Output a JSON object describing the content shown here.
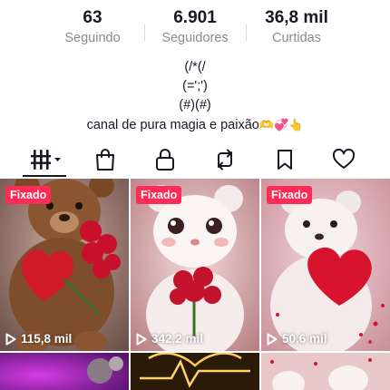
{
  "stats": {
    "following": {
      "value": "63",
      "label": "Seguindo"
    },
    "followers": {
      "value": "6.901",
      "label": "Seguidores"
    },
    "likes": {
      "value": "36,8 mil",
      "label": "Curtidas"
    }
  },
  "bio": {
    "lines": [
      "(/*(/",
      "(=';')",
      "(#)(#)"
    ],
    "text": "canal de pura magia e paixão",
    "emojis": "🫶💞👆"
  },
  "tabs": [
    {
      "name": "videos",
      "icon": "grid-bars-icon",
      "selected": true
    },
    {
      "name": "shop",
      "icon": "shopping-bag-icon"
    },
    {
      "name": "private",
      "icon": "lock-icon"
    },
    {
      "name": "reposts",
      "icon": "repost-icon"
    },
    {
      "name": "favorites",
      "icon": "bookmark-icon"
    },
    {
      "name": "liked",
      "icon": "heart-icon"
    }
  ],
  "videos": [
    {
      "pinned_label": "Fixado",
      "views": "115,8 mil"
    },
    {
      "pinned_label": "Fixado",
      "views": "342,2 mil"
    },
    {
      "pinned_label": "Fixado",
      "views": "50,6 mil"
    }
  ],
  "colors": {
    "accent": "#fe2c55",
    "text": "#161823",
    "muted": "#8a8b91"
  }
}
